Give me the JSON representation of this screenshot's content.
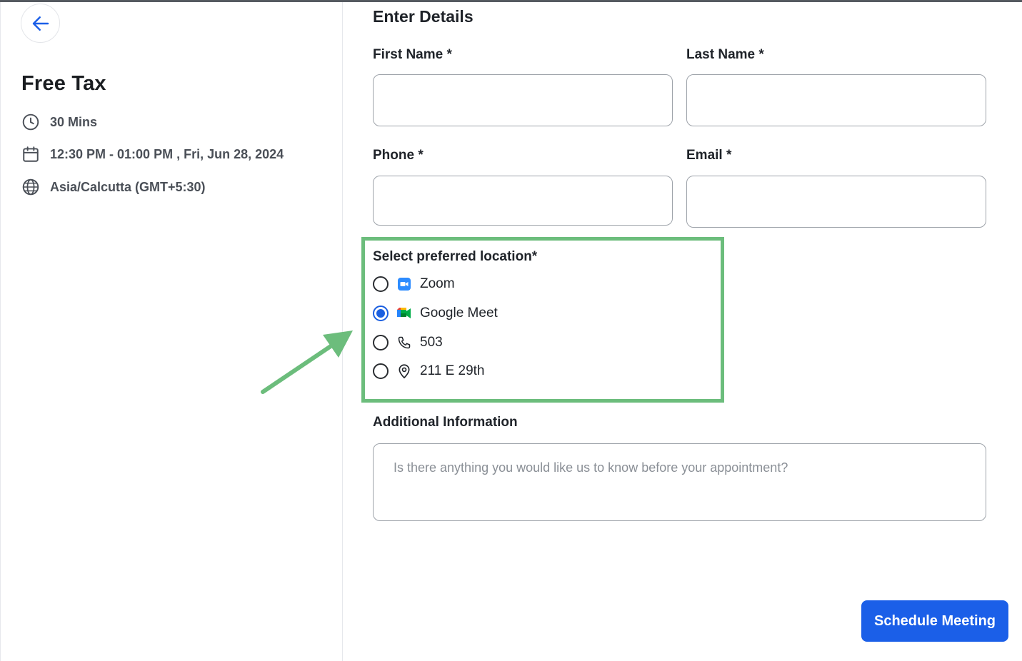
{
  "event": {
    "title": "Free Tax",
    "duration": "30 Mins",
    "datetime": "12:30 PM - 01:00 PM , Fri, Jun 28, 2024",
    "timezone": "Asia/Calcutta (GMT+5:30)"
  },
  "form": {
    "title": "Enter Details",
    "first_name_label": "First Name *",
    "last_name_label": "Last Name *",
    "phone_label": "Phone *",
    "email_label": "Email *",
    "location_label": "Select preferred location*",
    "locations": [
      {
        "label": "Zoom",
        "icon": "zoom-icon",
        "selected": false
      },
      {
        "label": "Google Meet",
        "icon": "google-meet-icon",
        "selected": true
      },
      {
        "label": "503",
        "icon": "phone-icon",
        "selected": false
      },
      {
        "label": "211 E 29th",
        "icon": "location-pin-icon",
        "selected": false
      }
    ],
    "additional_label": "Additional Information",
    "additional_placeholder": "Is there anything you would like us to know before your appointment?",
    "submit_label": "Schedule Meeting"
  },
  "colors": {
    "accent": "#1b5fe8",
    "highlight_box": "#6cbd7c",
    "arrow": "#6cbd7c"
  }
}
